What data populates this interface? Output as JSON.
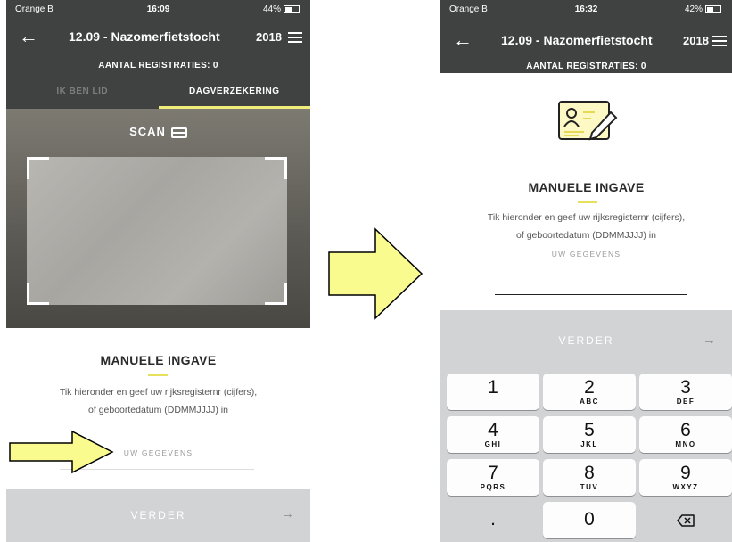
{
  "left_screen": {
    "status": {
      "carrier": "Orange B",
      "time": "16:09",
      "battery": "44%"
    },
    "header": {
      "back_icon": "arrow-left-icon",
      "title": "12.09 - Nazomerfietstocht",
      "year": "2018",
      "menu_icon": "hamburger-menu-icon",
      "registrations": "AANTAL REGISTRATIES: 0"
    },
    "tabs": [
      {
        "label": "IK BEN LID",
        "active": false
      },
      {
        "label": "DAGVERZEKERING",
        "active": true
      }
    ],
    "scan": {
      "label": "SCAN",
      "icon": "card-icon"
    },
    "manual": {
      "heading": "MANUELE INGAVE",
      "line1": "Tik hieronder en geef uw rijksregisternr (cijfers),",
      "line2": "of geboortedatum (DDMMJJJJ) in",
      "field_placeholder": "UW GEGEVENS"
    },
    "next": {
      "label": "VERDER",
      "arrow": "→"
    }
  },
  "right_screen": {
    "status": {
      "carrier": "Orange B",
      "time": "16:32",
      "battery": "42%"
    },
    "header": {
      "back_icon": "arrow-left-icon",
      "title": "12.09 - Nazomerfietstocht",
      "year": "2018",
      "menu_icon": "hamburger-menu-icon",
      "registrations": "AANTAL REGISTRATIES: 0"
    },
    "manual": {
      "icon": "id-card-pencil-icon",
      "heading": "MANUELE INGAVE",
      "line1": "Tik hieronder en geef uw rijksregisternr (cijfers),",
      "line2": "of geboortedatum (DDMMJJJJ) in",
      "field_placeholder": "UW GEGEVENS"
    },
    "next": {
      "label": "VERDER",
      "arrow": "→"
    },
    "keypad": {
      "keys": [
        {
          "num": "1",
          "letters": ""
        },
        {
          "num": "2",
          "letters": "ABC"
        },
        {
          "num": "3",
          "letters": "DEF"
        },
        {
          "num": "4",
          "letters": "GHI"
        },
        {
          "num": "5",
          "letters": "JKL"
        },
        {
          "num": "6",
          "letters": "MNO"
        },
        {
          "num": "7",
          "letters": "PQRS"
        },
        {
          "num": "8",
          "letters": "TUV"
        },
        {
          "num": "9",
          "letters": "WXYZ"
        },
        {
          "num": ".",
          "letters": ""
        },
        {
          "num": "0",
          "letters": ""
        }
      ],
      "backspace_icon": "backspace-icon"
    }
  },
  "colors": {
    "header_bg": "#3f4241",
    "accent_yellow": "#f1ed7a",
    "arrow_yellow": "#fafb8f",
    "button_bg": "#d1d3d5"
  }
}
